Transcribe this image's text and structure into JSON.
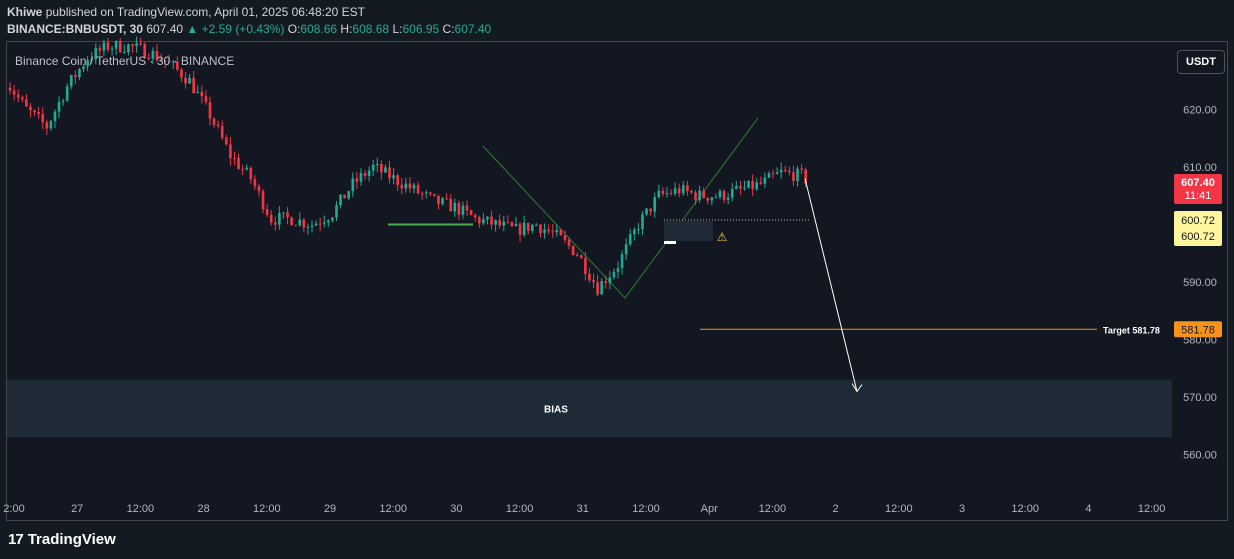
{
  "header": {
    "author": "Khiwe",
    "published": "published on TradingView.com, April 01, 2025 06:48:20 EST",
    "symbol": "BINANCE:BNBUSDT, 30",
    "last": "607.40",
    "change": "▲ +2.59 (+0.43%)",
    "o_label": "O:",
    "o": "608.66",
    "h_label": "H:",
    "h": "608.68",
    "l_label": "L:",
    "l": "606.95",
    "c_label": "C:",
    "c": "607.40"
  },
  "chart_title": "Binance Coin / TetherUS · 30 · BINANCE",
  "currency_button": "USDT",
  "footer_logo": "TradingView",
  "colors": {
    "up": "#22ab94",
    "down": "#f23645",
    "support": "#4caf50",
    "target": "#f7931a",
    "bias_zone": "#1e2a35",
    "wedge": "#2e7d32"
  },
  "chart_data": {
    "type": "candlestick",
    "ylim": [
      550,
      630
    ],
    "y_ticks": [
      "620.00",
      "610.00",
      "600.00",
      "590.00",
      "580.00",
      "570.00",
      "560.00"
    ],
    "x_ticks": [
      "2:00",
      "27",
      "12:00",
      "28",
      "12:00",
      "29",
      "12:00",
      "30",
      "12:00",
      "31",
      "12:00",
      "Apr",
      "12:00",
      "2",
      "12:00",
      "3",
      "12:00",
      "4",
      "12:00"
    ],
    "price_path": [
      [
        0,
        625
      ],
      [
        1,
        620
      ],
      [
        2,
        617
      ],
      [
        3,
        624
      ],
      [
        4,
        629
      ],
      [
        5,
        631
      ],
      [
        6,
        631
      ],
      [
        7,
        630
      ],
      [
        8,
        628
      ],
      [
        9,
        625
      ],
      [
        10,
        619
      ],
      [
        11,
        612
      ],
      [
        12,
        608
      ],
      [
        13,
        601
      ],
      [
        14,
        601
      ],
      [
        15,
        600
      ],
      [
        16,
        602
      ],
      [
        17,
        607
      ],
      [
        18,
        610
      ],
      [
        19,
        608
      ],
      [
        20,
        606
      ],
      [
        21,
        604
      ],
      [
        22,
        603
      ],
      [
        23,
        601
      ],
      [
        24,
        600
      ],
      [
        25,
        599
      ],
      [
        26,
        600
      ],
      [
        27,
        598
      ],
      [
        28,
        595
      ],
      [
        29,
        589
      ],
      [
        30,
        593
      ],
      [
        31,
        600
      ],
      [
        32,
        605
      ],
      [
        33,
        606
      ],
      [
        34,
        605
      ],
      [
        35,
        605
      ],
      [
        36,
        606
      ],
      [
        37,
        607
      ],
      [
        38,
        609
      ],
      [
        39,
        608.5
      ],
      [
        39.3,
        607.4
      ]
    ],
    "current_price": "607.40",
    "countdown": "11:41",
    "level_labels": [
      "600.72",
      "600.72"
    ],
    "target": {
      "label": "Target",
      "value": "581.78"
    },
    "support_level": 600,
    "zone": {
      "label": "BIAS",
      "from": 563,
      "to": 573
    },
    "arrow": {
      "from": 608,
      "to": 572
    }
  }
}
